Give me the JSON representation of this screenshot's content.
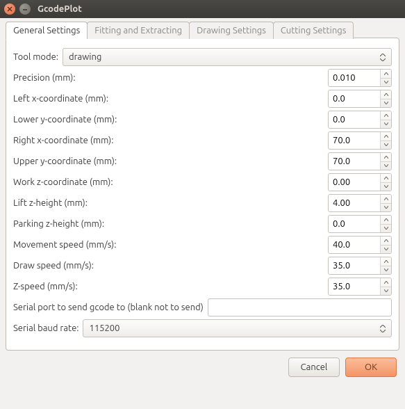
{
  "window": {
    "title": "GcodePlot"
  },
  "tabs": {
    "items": [
      {
        "label": "General Settings",
        "active": true
      },
      {
        "label": "Fitting and Extracting",
        "active": false
      },
      {
        "label": "Drawing Settings",
        "active": false
      },
      {
        "label": "Cutting Settings",
        "active": false
      }
    ]
  },
  "form": {
    "tool_mode": {
      "label": "Tool mode:",
      "value": "drawing"
    },
    "precision": {
      "label": "Precision (mm):",
      "value": "0.010"
    },
    "left_x": {
      "label": "Left x-coordinate (mm):",
      "value": "0.0"
    },
    "lower_y": {
      "label": "Lower y-coordinate (mm):",
      "value": "0.0"
    },
    "right_x": {
      "label": "Right x-coordinate (mm):",
      "value": "70.0"
    },
    "upper_y": {
      "label": "Upper y-coordinate (mm):",
      "value": "70.0"
    },
    "work_z": {
      "label": "Work z-coordinate (mm):",
      "value": "0.00"
    },
    "lift_z": {
      "label": "Lift z-height (mm):",
      "value": "4.00"
    },
    "park_z": {
      "label": "Parking z-height (mm):",
      "value": "0.0"
    },
    "move_spd": {
      "label": "Movement speed (mm/s):",
      "value": "40.0"
    },
    "draw_spd": {
      "label": "Draw speed (mm/s):",
      "value": "35.0"
    },
    "z_spd": {
      "label": "Z-speed (mm/s):",
      "value": "35.0"
    },
    "serial": {
      "label": "Serial port to send gcode to (blank not to send)",
      "value": ""
    },
    "baud": {
      "label": "Serial baud rate:",
      "value": "115200"
    }
  },
  "footer": {
    "cancel": "Cancel",
    "ok": "OK"
  }
}
